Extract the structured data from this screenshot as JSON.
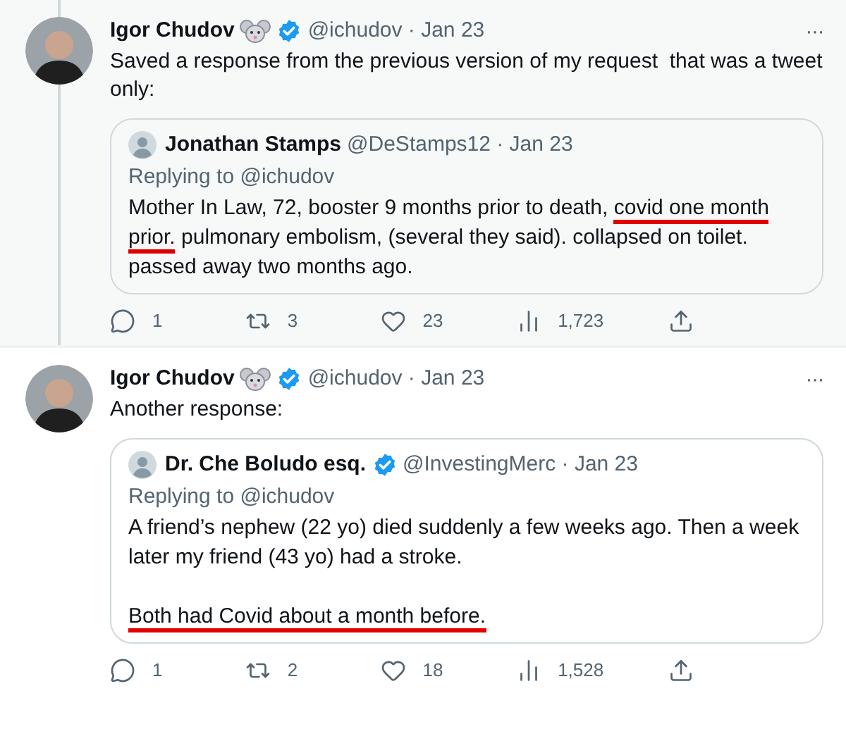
{
  "tweets": [
    {
      "highlighted": true,
      "thread_line": true,
      "author": {
        "name": "Igor Chudov",
        "verified": true,
        "meta": "@ichudov · Jan 23"
      },
      "more": "···",
      "text": "Saved a response from the previous version of my request  that was a tweet only:",
      "quote": {
        "name": "Jonathan Stamps",
        "verified": false,
        "meta": "@DeStamps12 · Jan 23",
        "replying": "Replying to @ichudov",
        "paragraphs": [
          [
            {
              "text": "Mother In Law, 72, booster 9 months prior to death, ",
              "marked": false
            },
            {
              "text": "covid one month prior.",
              "marked": true
            },
            {
              "text": " pulmonary embolism, (several they said). collapsed on toilet. passed away two months ago.",
              "marked": false
            }
          ]
        ]
      },
      "actions": [
        {
          "kind": "reply",
          "count": "1"
        },
        {
          "kind": "retweet",
          "count": "3"
        },
        {
          "kind": "like",
          "count": "23"
        },
        {
          "kind": "views",
          "count": "1,723"
        },
        {
          "kind": "share"
        }
      ]
    },
    {
      "highlighted": false,
      "thread_line": false,
      "author": {
        "name": "Igor Chudov",
        "verified": true,
        "meta": "@ichudov · Jan 23"
      },
      "more": "···",
      "text": "Another response:",
      "quote": {
        "name": "Dr. Che Boludo esq.",
        "verified": true,
        "meta": "@InvestingMerc · Jan 23",
        "replying": "Replying to @ichudov",
        "paragraphs": [
          [
            {
              "text": "A friend’s nephew (22 yo) died suddenly a few weeks ago. Then a week later my friend (43 yo) had a stroke.",
              "marked": false
            }
          ],
          [
            {
              "text": "Both had Covid about a month before.",
              "marked": true
            }
          ]
        ]
      },
      "actions": [
        {
          "kind": "reply",
          "count": "1"
        },
        {
          "kind": "retweet",
          "count": "2"
        },
        {
          "kind": "like",
          "count": "18"
        },
        {
          "kind": "views",
          "count": "1,528"
        },
        {
          "kind": "share"
        }
      ]
    }
  ]
}
